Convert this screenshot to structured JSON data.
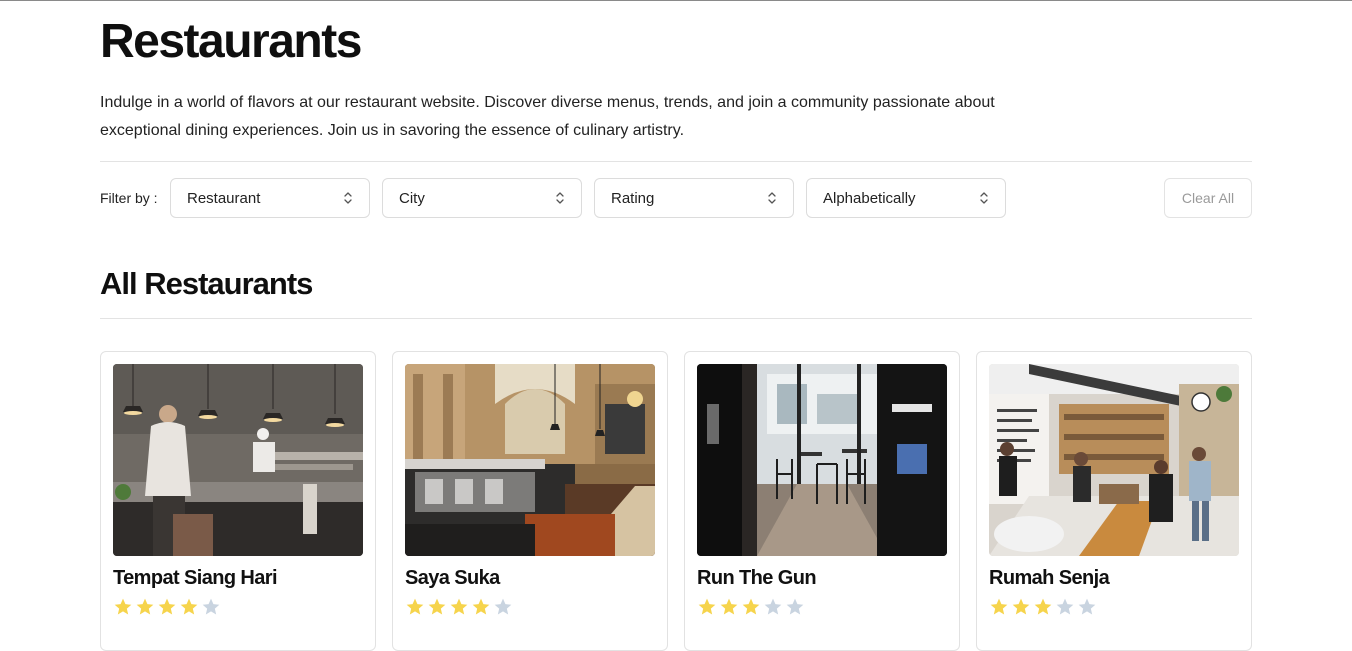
{
  "header": {
    "title": "Restaurants",
    "intro": "Indulge in a world of flavors at our restaurant website. Discover diverse menus, trends, and join a community passionate about exceptional dining experiences. Join us in savoring the essence of culinary artistry."
  },
  "filters": {
    "label": "Filter by :",
    "selects": [
      {
        "label": "Restaurant"
      },
      {
        "label": "City"
      },
      {
        "label": "Rating"
      },
      {
        "label": "Alphabetically"
      }
    ],
    "clear_label": "Clear All"
  },
  "section": {
    "title": "All Restaurants"
  },
  "colors": {
    "star_filled": "#f6d44c",
    "star_empty": "#c9d4e0"
  },
  "restaurants": [
    {
      "name": "Tempat Siang Hari",
      "rating": 4,
      "image": "kitchen-photo"
    },
    {
      "name": "Saya Suka",
      "rating": 4,
      "image": "hall-bar-photo"
    },
    {
      "name": "Run The Gun",
      "rating": 3,
      "image": "cafe-interior-photo"
    },
    {
      "name": "Rumah Senja",
      "rating": 3,
      "image": "deli-counter-photo"
    }
  ]
}
